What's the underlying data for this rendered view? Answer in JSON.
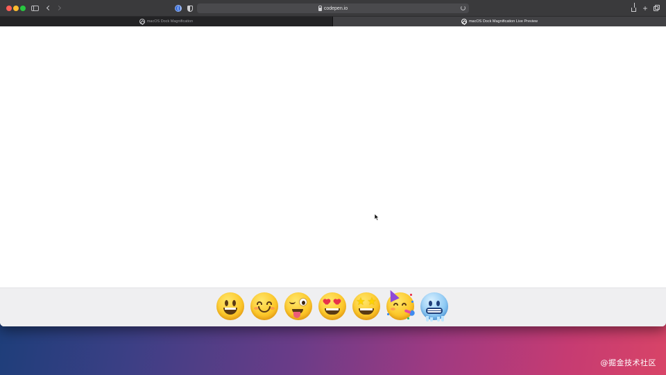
{
  "browser": {
    "address": "codepen.io",
    "tabs": [
      {
        "label": "macOS Dock Magnification",
        "active": false
      },
      {
        "label": "macOS Dock Magnification Live Preview",
        "active": true
      }
    ]
  },
  "dock": {
    "items": [
      {
        "name": "grinning-face-with-big-eyes",
        "glyph": "😃"
      },
      {
        "name": "smiling-face-with-smiling-eyes",
        "glyph": "😊"
      },
      {
        "name": "winking-face-with-tongue",
        "glyph": "😜"
      },
      {
        "name": "smiling-face-with-heart-eyes",
        "glyph": "😍"
      },
      {
        "name": "star-struck",
        "glyph": "🤩"
      },
      {
        "name": "partying-face",
        "glyph": "🥳"
      },
      {
        "name": "cold-face",
        "glyph": "🥶"
      }
    ]
  },
  "watermark": "@掘金技术社区",
  "colors": {
    "window_chrome": "#3a3a3c",
    "active_tab": "#414144",
    "inactive_tab": "#232325",
    "dock_bg": "#efeff1",
    "traffic_red": "#ff5f57",
    "traffic_yellow": "#febc2e",
    "traffic_green": "#28c840"
  }
}
